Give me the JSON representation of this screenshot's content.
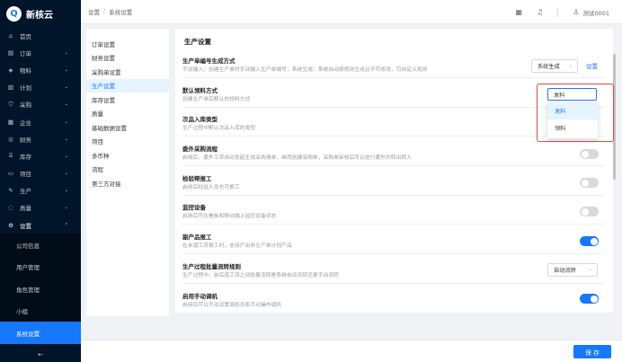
{
  "app": {
    "logo_letter": "Q",
    "name": "新核云"
  },
  "sidebar": {
    "items": [
      {
        "icon": "⌂",
        "icon_name": "home-icon",
        "label": "首页",
        "chevron": ""
      },
      {
        "icon": "▤",
        "icon_name": "order-icon",
        "label": "订单",
        "chevron": "⌄"
      },
      {
        "icon": "◈",
        "icon_name": "material-icon",
        "label": "物料",
        "chevron": "⌄"
      },
      {
        "icon": "▥",
        "icon_name": "plan-icon",
        "label": "计划",
        "chevron": "⌄"
      },
      {
        "icon": "⛉",
        "icon_name": "purchase-icon",
        "label": "采购",
        "chevron": "⌄"
      },
      {
        "icon": "▦",
        "icon_name": "enterprise-icon",
        "label": "企业",
        "chevron": "⌄"
      },
      {
        "icon": "◎",
        "icon_name": "finance-icon",
        "label": "财务",
        "chevron": "⌄"
      },
      {
        "icon": "⌸",
        "icon_name": "inventory-icon",
        "label": "库存",
        "chevron": "⌄"
      },
      {
        "icon": "▭",
        "icon_name": "project-icon",
        "label": "项目",
        "chevron": "⌄"
      },
      {
        "icon": "✎",
        "icon_name": "production-icon",
        "label": "生产",
        "chevron": "⌄"
      },
      {
        "icon": "◌",
        "icon_name": "quality-icon",
        "label": "质量",
        "chevron": "⌄"
      },
      {
        "icon": "⚙",
        "icon_name": "settings-icon",
        "label": "设置",
        "chevron": "⌃"
      }
    ],
    "submenu": [
      {
        "label": "公司信息"
      },
      {
        "label": "用户管理"
      },
      {
        "label": "角色管理"
      },
      {
        "label": "小组"
      },
      {
        "label": "系统设置"
      }
    ],
    "collapse_icon": "←"
  },
  "header": {
    "breadcrumb": [
      "设置",
      "/",
      "系统设置"
    ],
    "user_name": "测试0001",
    "qr_icon": "▦",
    "bell_icon": "♫",
    "user_icon": "♙"
  },
  "leftnav": {
    "items": [
      "订单设置",
      "财务设置",
      "采购单设置",
      "生产设置",
      "库存设置",
      "质量",
      "基础数据设置",
      "项目",
      "多币种",
      "流程",
      "第三方对接"
    ],
    "active_index": 3
  },
  "main": {
    "title": "生产设置",
    "settings": [
      {
        "title": "生产单编号生成方式",
        "desc": "手动输入：创建生产单时手动输入生产单编号；系统生成：系统自动按规则生成且不可修改，可自定义规则",
        "select": "系统生成",
        "link": "设置"
      },
      {
        "title": "默认领料方式",
        "desc": "创建生产单后默认的领料方式"
      },
      {
        "title": "次品入库类型",
        "desc": "生产过程中默认次品入库的类型"
      },
      {
        "title": "委外采购流程",
        "desc": "启用后，委外工序自动发起生成采购清单，继而创建采购单，采购单审核后可以进行委外的转出转入",
        "toggle": false
      },
      {
        "title": "检验帮报工",
        "desc": "启用后检验人员也可报工",
        "toggle": false
      },
      {
        "title": "监控设备",
        "desc": "启用后可在看板和移动端上监控设备状态",
        "toggle": false
      },
      {
        "title": "副产品报工",
        "desc": "在末道工序报工时，支持产出非生产单计划产品",
        "toggle": true
      },
      {
        "title": "生产过程批量流转规则",
        "desc": "生产过程中，前后道工序之间批量流转是系统自动流转还是手动流转",
        "select": "自动流转"
      },
      {
        "title": "启用手动调机",
        "desc": "启用后可以手动设置调机员和手动操作调机",
        "toggle": true
      }
    ]
  },
  "dropdown": {
    "value": "发料",
    "options": [
      "发料",
      "领料"
    ]
  },
  "footer": {
    "save_label": "保 存"
  },
  "colors": {
    "primary": "#1677ff",
    "sidebar_bg": "#001529",
    "highlight_border": "#e04a3a"
  }
}
